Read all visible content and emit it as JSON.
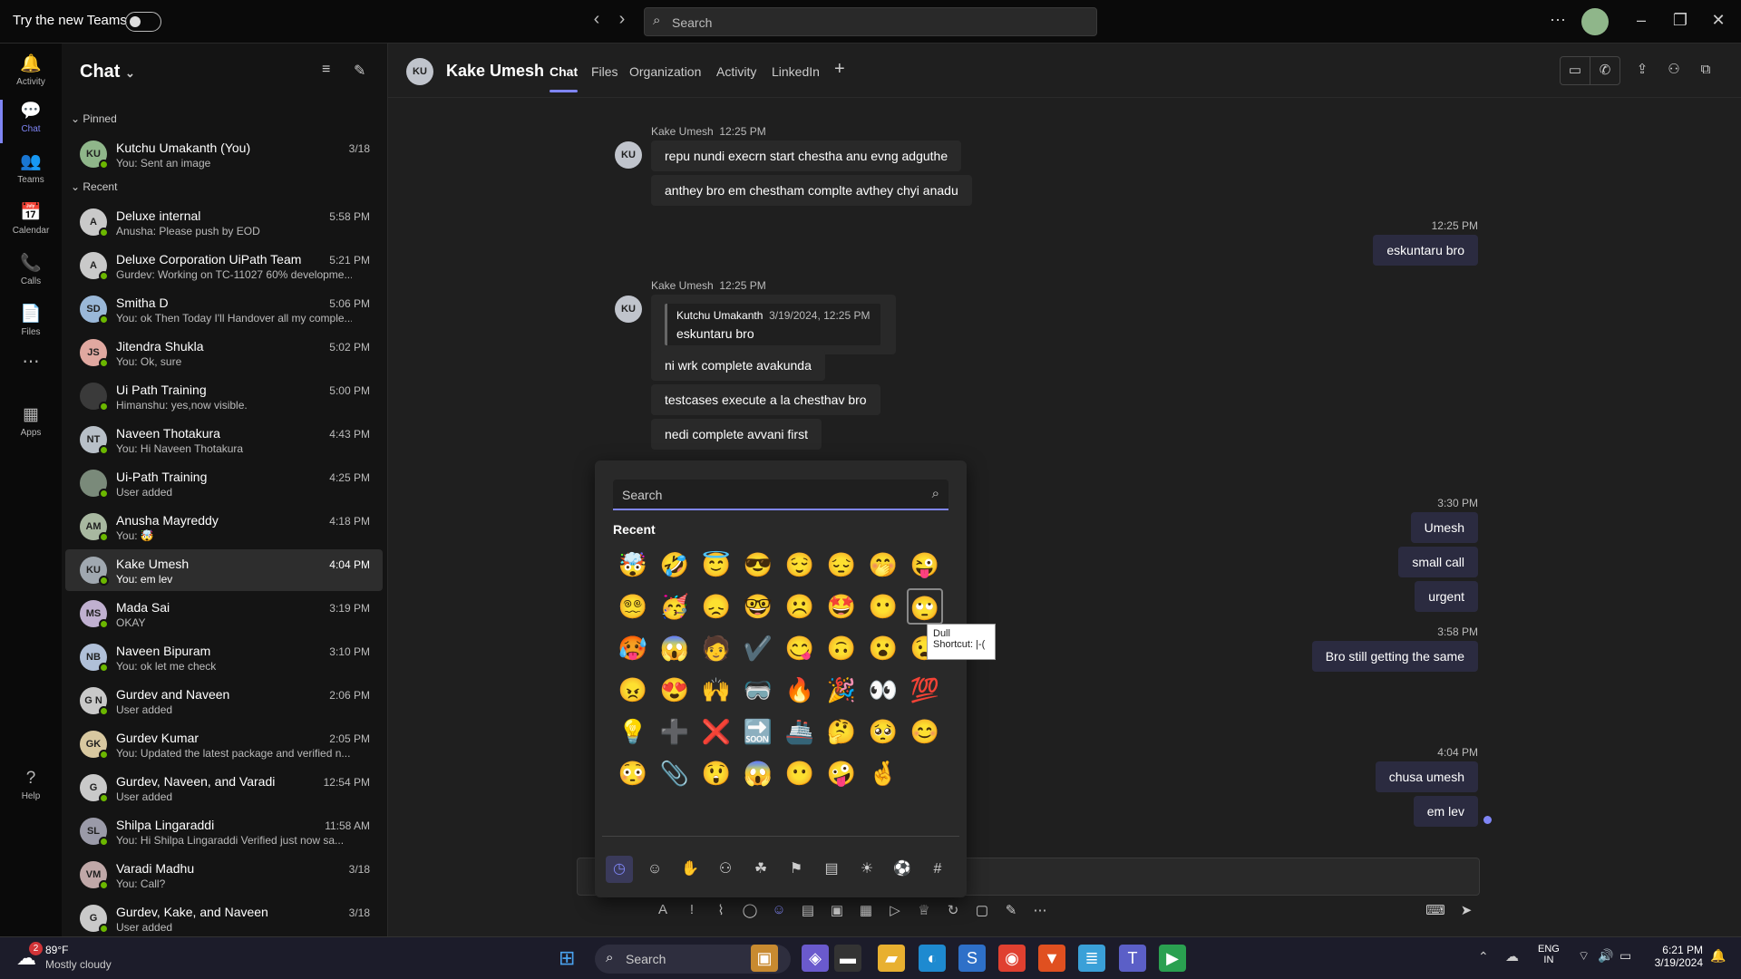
{
  "titlebar": {
    "try_new_teams": "Try the new Teams",
    "search_placeholder": "Search",
    "more_label": "⋯"
  },
  "rail": [
    {
      "label": "Activity",
      "icon": "bell-icon",
      "glyph": "🔔"
    },
    {
      "label": "Chat",
      "icon": "chat-icon",
      "glyph": "💬"
    },
    {
      "label": "Teams",
      "icon": "teams-icon",
      "glyph": "👥"
    },
    {
      "label": "Calendar",
      "icon": "calendar-icon",
      "glyph": "📅"
    },
    {
      "label": "Calls",
      "icon": "phone-icon",
      "glyph": "📞"
    },
    {
      "label": "Files",
      "icon": "file-icon",
      "glyph": "📄"
    },
    {
      "label": "",
      "icon": "more-icon",
      "glyph": "⋯"
    },
    {
      "label": "Apps",
      "icon": "apps-icon",
      "glyph": "▦"
    },
    {
      "label": "Help",
      "icon": "help-icon",
      "glyph": "?"
    }
  ],
  "chatlist": {
    "title": "Chat",
    "pinned_label": "Pinned",
    "recent_label": "Recent",
    "pinned": [
      {
        "initials": "KU",
        "name": "Kutchu Umakanth (You)",
        "preview": "You: Sent an image",
        "time": "3/18",
        "color": "#8fb68a"
      }
    ],
    "recent": [
      {
        "initials": "A",
        "name": "Deluxe internal",
        "preview": "Anusha: Please push by EOD",
        "time": "5:58 PM",
        "color": "#c9c9c9"
      },
      {
        "initials": "A",
        "name": "Deluxe Corporation UiPath Team",
        "preview": "Gurdev: Working on TC-11027 60% developme...",
        "time": "5:21 PM",
        "color": "#c9c9c9"
      },
      {
        "initials": "SD",
        "name": "Smitha D",
        "preview": "You: ok Then Today I'll Handover all my comple...",
        "time": "5:06 PM",
        "color": "#9ab8d8"
      },
      {
        "initials": "JS",
        "name": "Jitendra Shukla",
        "preview": "You: Ok, sure",
        "time": "5:02 PM",
        "color": "#e0a8a0"
      },
      {
        "initials": "",
        "name": "Ui Path Training",
        "preview": "Himanshu: yes,now visible.",
        "time": "5:00 PM",
        "color": "#3a3a3a"
      },
      {
        "initials": "NT",
        "name": "Naveen Thotakura",
        "preview": "You: Hi Naveen Thotakura",
        "time": "4:43 PM",
        "color": "#b8c0c8"
      },
      {
        "initials": "",
        "name": "Ui-Path Training",
        "preview": "User added",
        "time": "4:25 PM",
        "color": "#7a8a7a"
      },
      {
        "initials": "AM",
        "name": "Anusha Mayreddy",
        "preview": "You: 🤯",
        "time": "4:18 PM",
        "color": "#a8b8a0"
      },
      {
        "initials": "KU",
        "name": "Kake Umesh",
        "preview": "You: em lev",
        "time": "4:04 PM",
        "color": "#a0a8b0"
      },
      {
        "initials": "MS",
        "name": "Mada Sai",
        "preview": "OKAY",
        "time": "3:19 PM",
        "color": "#c0b0d0"
      },
      {
        "initials": "NB",
        "name": "Naveen Bipuram",
        "preview": "You: ok let me check",
        "time": "3:10 PM",
        "color": "#b0c0d8"
      },
      {
        "initials": "G N",
        "name": "Gurdev and Naveen",
        "preview": "User added",
        "time": "2:06 PM",
        "color": "#c9c9c9"
      },
      {
        "initials": "GK",
        "name": "Gurdev Kumar",
        "preview": "You: Updated the latest package and verified n...",
        "time": "2:05 PM",
        "color": "#d8c8a0"
      },
      {
        "initials": "G",
        "name": "Gurdev, Naveen, and Varadi",
        "preview": "User added",
        "time": "12:54 PM",
        "color": "#c9c9c9"
      },
      {
        "initials": "SL",
        "name": "Shilpa Lingaraddi",
        "preview": "You: Hi Shilpa Lingaraddi Verified just now sa...",
        "time": "11:58 AM",
        "color": "#9a9aa8"
      },
      {
        "initials": "VM",
        "name": "Varadi Madhu",
        "preview": "You: Call?",
        "time": "3/18",
        "color": "#c0a8a8"
      },
      {
        "initials": "G",
        "name": "Gurdev, Kake, and Naveen",
        "preview": "User added",
        "time": "3/18",
        "color": "#c9c9c9"
      }
    ]
  },
  "header": {
    "initials": "KU",
    "name": "Kake Umesh",
    "tabs": [
      "Chat",
      "Files",
      "Organization",
      "Activity",
      "LinkedIn"
    ],
    "add_tab": "+"
  },
  "messages": {
    "sender1": "Kake Umesh",
    "time1": "12:25 PM",
    "m1": "repu nundi execrn start chestha anu evng adguthe",
    "m2": "anthey bro em chestham complte avthey chyi anadu",
    "my_time1": "12:25 PM",
    "mine1": "eskuntaru bro",
    "sender2": "Kake Umesh",
    "time2": "12:25 PM",
    "quote_author": "Kutchu Umakanth",
    "quote_time": "3/19/2024, 12:25 PM",
    "quote_text": "eskuntaru bro",
    "m3": "ni wrk complete avakunda",
    "m4": "testcases execute a la chesthav bro",
    "m5": "nedi complete avvani first",
    "my_time2": "3:30 PM",
    "mine2": "Umesh",
    "mine3": "small call",
    "mine4": "urgent",
    "my_time3": "3:58 PM",
    "mine5": "Bro still getting the same",
    "my_time4": "4:04 PM",
    "mine6": "chusa umesh",
    "mine7": "em lev"
  },
  "emoji_panel": {
    "search_placeholder": "Search",
    "recent_label": "Recent",
    "tooltip_name": "Dull",
    "tooltip_shortcut": "Shortcut: |-(",
    "emojis": [
      "🤯",
      "🤣",
      "😇",
      "😎",
      "😌",
      "😔",
      "🤭",
      "😜",
      "😵‍💫",
      "🥳",
      "😞",
      "🤓",
      "☹️",
      "🤩",
      "😶",
      "🙄",
      "🥵",
      "😱",
      "🧑",
      "✔️",
      "😋",
      "🙃",
      "😮",
      "😧",
      "😠",
      "😍",
      "🙌",
      "🥽",
      "🔥",
      "🎉",
      "👀",
      "💯",
      "💡",
      "➕",
      "❌",
      "🔜",
      "🚢",
      "🤔",
      "🥺",
      "😊",
      "😳",
      "📎",
      "😲",
      "😱",
      "😶",
      "🤪",
      "🤞"
    ],
    "categories": [
      {
        "icon": "clock-icon",
        "glyph": "◷"
      },
      {
        "icon": "smile-icon",
        "glyph": "☺"
      },
      {
        "icon": "hand-icon",
        "glyph": "✋"
      },
      {
        "icon": "people-icon",
        "glyph": "⚇"
      },
      {
        "icon": "animal-icon",
        "glyph": "☘"
      },
      {
        "icon": "flag-icon",
        "glyph": "⚑"
      },
      {
        "icon": "building-icon",
        "glyph": "▤"
      },
      {
        "icon": "bulb-icon",
        "glyph": "☀"
      },
      {
        "icon": "ball-icon",
        "glyph": "⚽"
      },
      {
        "icon": "symbol-icon",
        "glyph": "#"
      }
    ]
  },
  "taskbar": {
    "weather_temp": "89°F",
    "weather_desc": "Mostly cloudy",
    "weather_badge": "2",
    "search_placeholder": "Search",
    "lang1": "ENG",
    "lang2": "IN",
    "time": "6:21 PM",
    "date": "3/19/2024"
  }
}
